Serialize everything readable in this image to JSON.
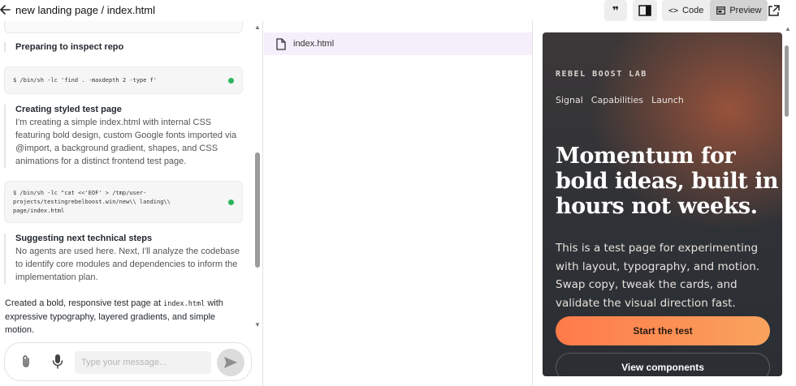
{
  "header": {
    "title": "new landing page / index.html",
    "code_label": "Code",
    "preview_label": "Preview"
  },
  "chat": {
    "steps": [
      {
        "title": "Preparing to inspect repo"
      },
      {
        "title": "Creating styled test page",
        "body": "I'm creating a simple index.html with internal CSS featuring bold design, custom Google fonts imported via @import, a background gradient, shapes, and CSS animations for a distinct frontend test page."
      },
      {
        "title": "Suggesting next technical steps",
        "body": "No agents are used here. Next, I'll analyze the codebase to identify core modules and dependencies to inform the implementation plan."
      }
    ],
    "commands": [
      {
        "text": "$ /bin/sh -lc 'find . -maxdepth 2 -type f'",
        "status": "success"
      },
      {
        "text": "$ /bin/sh -lc \"cat <<'EOF' > /tmp/user-projects/testingrebelboost.win/new\\\\ landing\\\\ page/index.html",
        "status": "success"
      }
    ],
    "final_message": {
      "before": "Created a bold, responsive test page at ",
      "code": "index.html",
      "after": " with expressive typography, layered gradients, and simple motion."
    },
    "input_placeholder": "Type your message..."
  },
  "files": {
    "items": [
      {
        "name": "index.html",
        "selected": true
      }
    ]
  },
  "preview": {
    "brand": "REBEL BOOST LAB",
    "nav": [
      "Signal",
      "Capabilities",
      "Launch"
    ],
    "hero": "Momentum for bold ideas, built in hours not weeks.",
    "subtext": "This is a test page for experimenting with layout, typography, and motion. Swap copy, tweak the cards, and validate the visual direction fast.",
    "primary_cta": "Start the test",
    "secondary_cta": "View components"
  },
  "colors": {
    "success_dot": "#2db55d",
    "selected_file_bg": "#f4effb",
    "cta_gradient_start": "#ff7a4a",
    "cta_gradient_end": "#f9a35e",
    "preview_bg": "#2e3136"
  }
}
